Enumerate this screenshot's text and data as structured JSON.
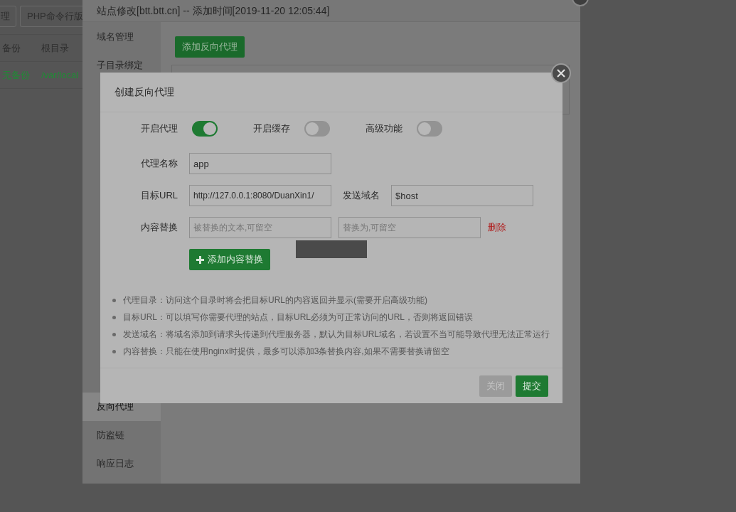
{
  "background": {
    "toolbar_buttons": [
      "理",
      "PHP命令行版"
    ],
    "table": {
      "columns": [
        "备份",
        "根目录"
      ],
      "rows": [
        {
          "backup": "无备份",
          "root": "/var/local"
        }
      ]
    }
  },
  "site_window": {
    "title": "站点修改[btt.btt.cn] -- 添加时间[2019-11-20 12:05:44]",
    "sidebar": [
      {
        "label": "域名管理",
        "selected": false
      },
      {
        "label": "子目录绑定",
        "selected": false
      },
      {
        "label": "反向代理",
        "selected": true
      },
      {
        "label": "防盗链",
        "selected": false
      },
      {
        "label": "响应日志",
        "selected": false
      }
    ],
    "add_button": "添加反向代理"
  },
  "dialog": {
    "title": "创建反向代理",
    "toggles": [
      {
        "label": "开启代理",
        "on": true
      },
      {
        "label": "开启缓存",
        "on": false
      },
      {
        "label": "高级功能",
        "on": false
      }
    ],
    "name_label": "代理名称",
    "name_value": "app",
    "url_label": "目标URL",
    "url_value": "http://127.0.0.1:8080/DuanXin1/",
    "host_label": "发送域名",
    "host_value": "$host",
    "replace_label": "内容替换",
    "replace_from_placeholder": "被替换的文本,可留空",
    "replace_to_placeholder": "替换为,可留空",
    "delete_link": "删除",
    "add_replace_button": "添加内容替换",
    "notes": [
      "代理目录：访问这个目录时将会把目标URL的内容返回并显示(需要开启高级功能)",
      "目标URL：可以填写你需要代理的站点，目标URL必须为可正常访问的URL，否则将返回错误",
      "发送域名：将域名添加到请求头传递到代理服务器，默认为目标URL域名，若设置不当可能导致代理无法正常运行",
      "内容替换：只能在使用nginx时提供，最多可以添加3条替换内容,如果不需要替换请留空"
    ],
    "buttons": [
      {
        "label": "关闭",
        "disabled": true
      },
      {
        "label": "提交",
        "disabled": false
      }
    ]
  }
}
